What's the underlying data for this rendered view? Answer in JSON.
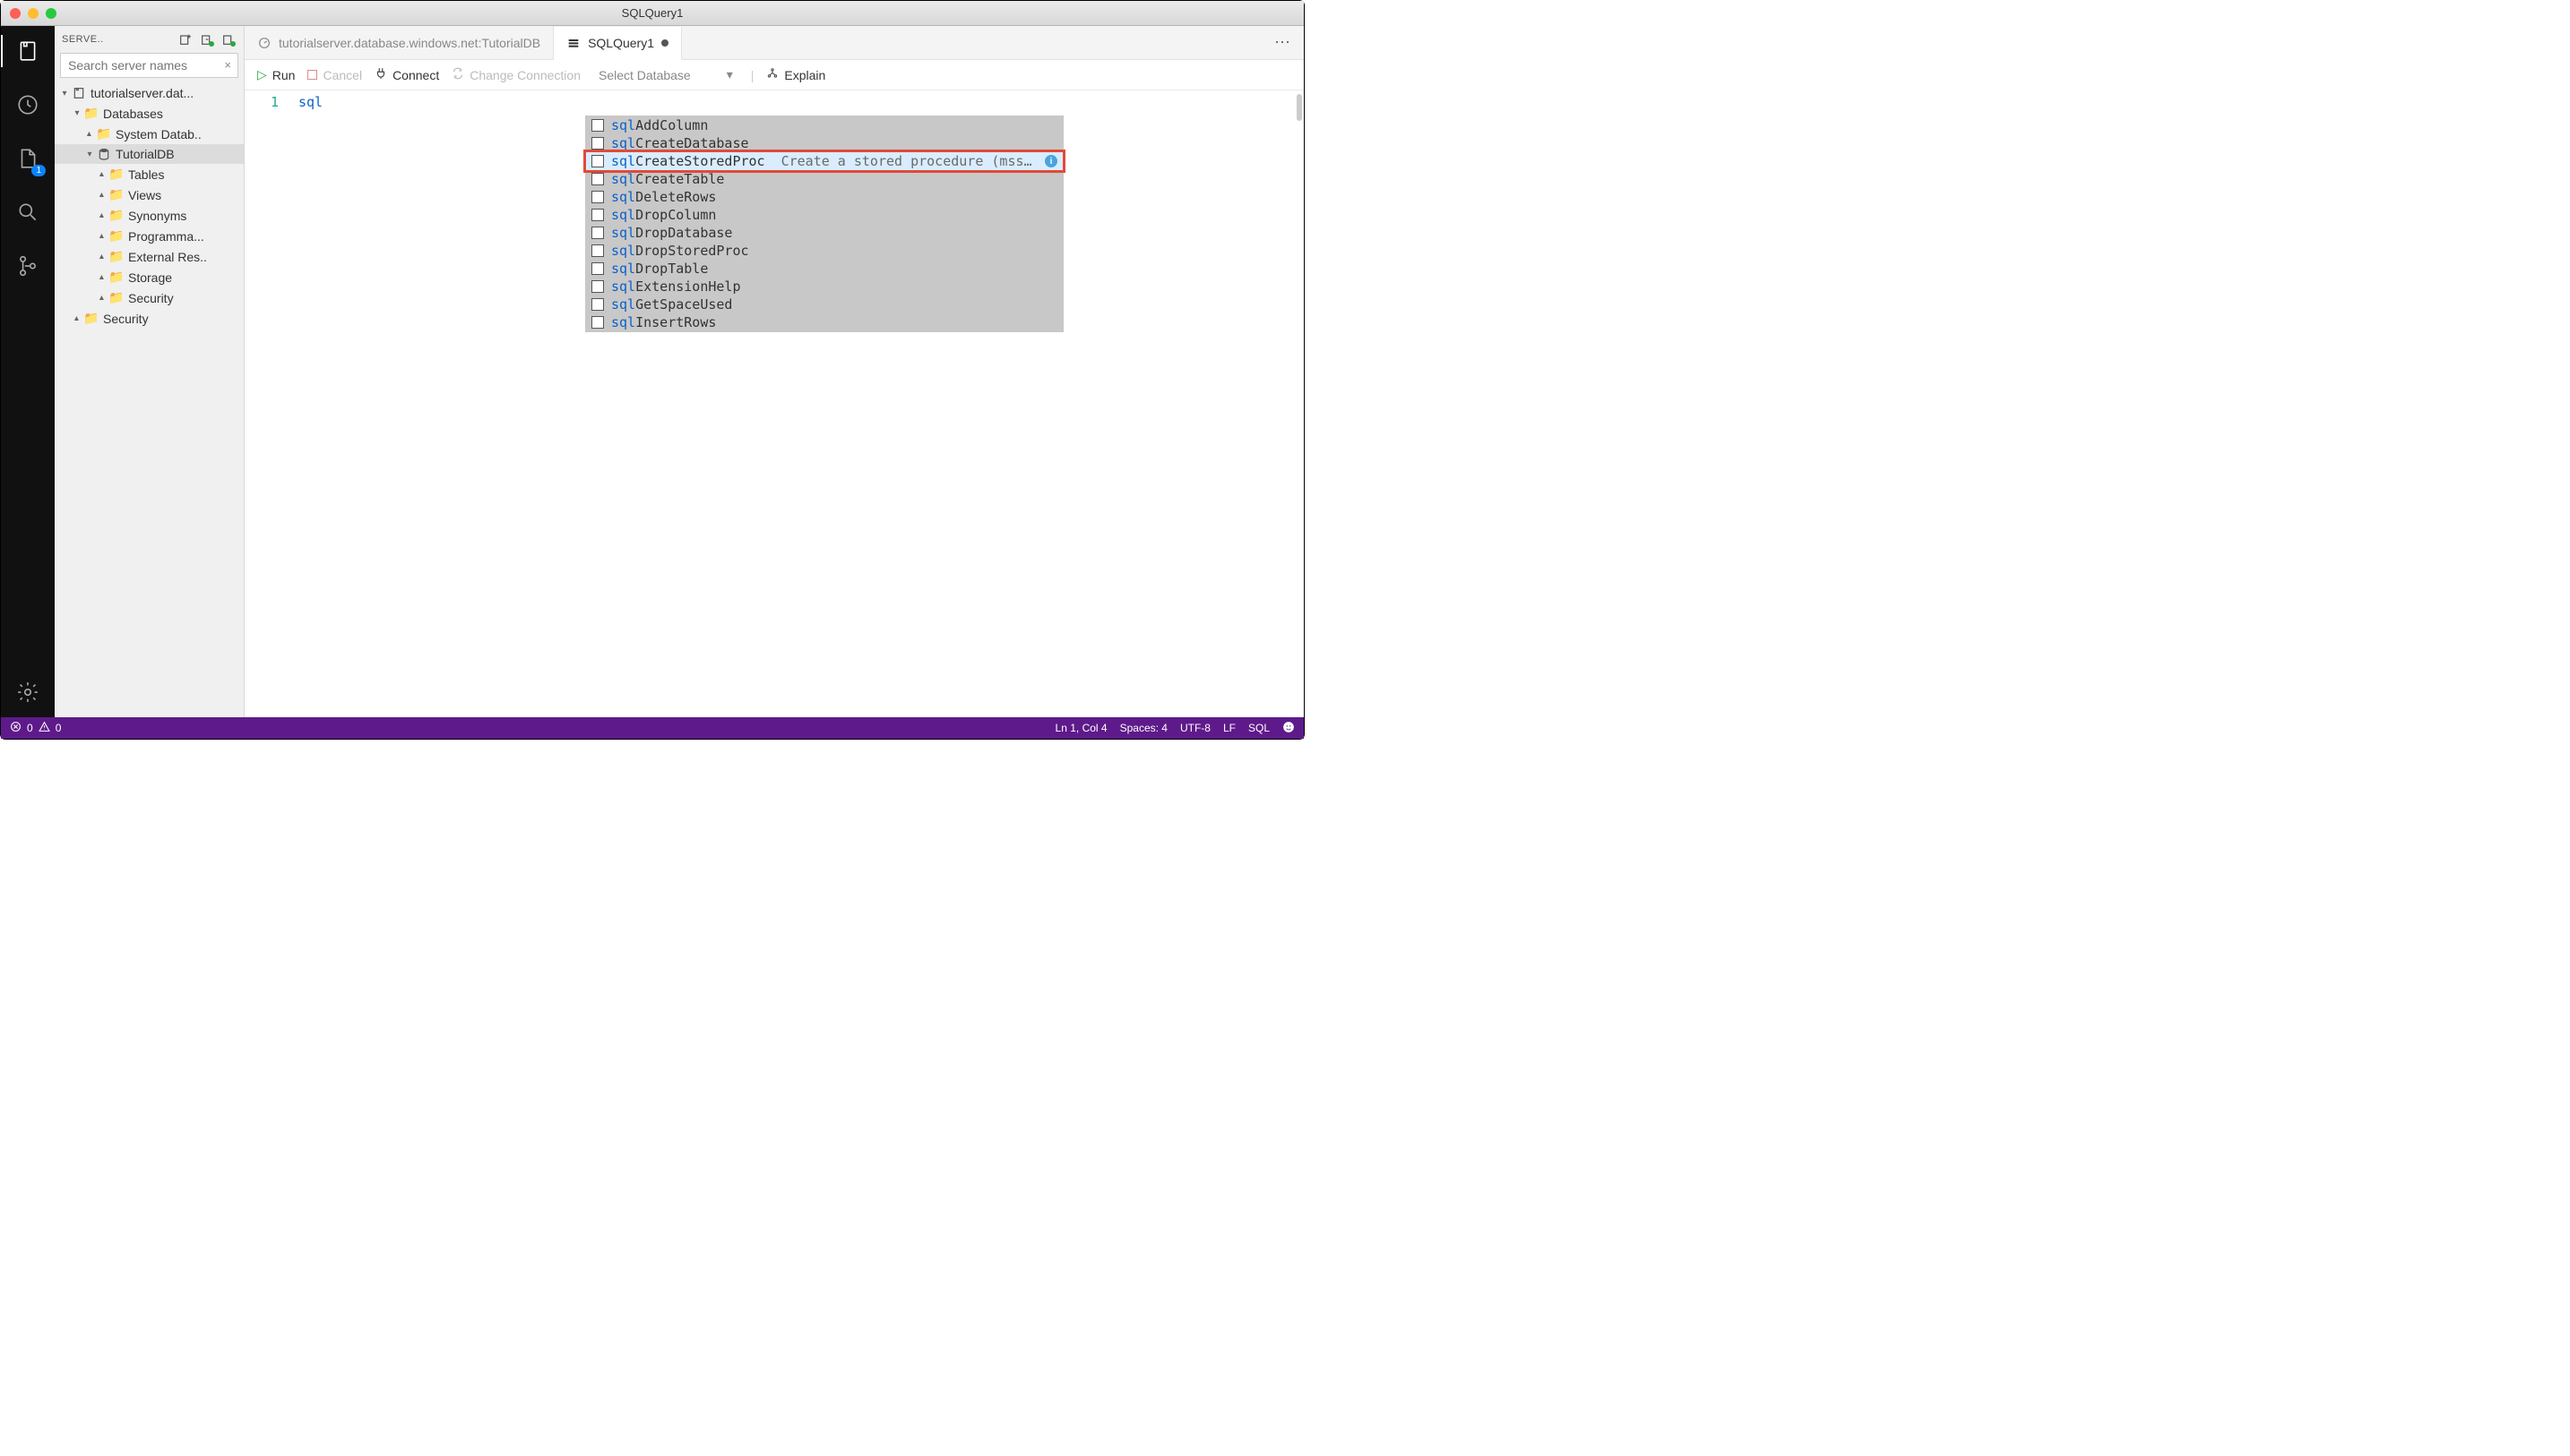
{
  "window": {
    "title": "SQLQuery1"
  },
  "sidebar": {
    "header_label": "SERVE..",
    "search_placeholder": "Search server names",
    "tree": {
      "server": "tutorialserver.dat...",
      "databases": "Databases",
      "systemdb": "System Datab..",
      "tutorialdb": "TutorialDB",
      "tables": "Tables",
      "views": "Views",
      "synonyms": "Synonyms",
      "programma": "Programma...",
      "extres": "External Res..",
      "storage": "Storage",
      "security_inner": "Security",
      "security_outer": "Security"
    }
  },
  "activitybar": {
    "badge": "1"
  },
  "tabs": {
    "server_tab": "tutorialserver.database.windows.net:TutorialDB",
    "query_tab": "SQLQuery1"
  },
  "toolbar": {
    "run": "Run",
    "cancel": "Cancel",
    "connect": "Connect",
    "change_conn": "Change Connection",
    "select_db": "Select Database",
    "explain": "Explain"
  },
  "editor": {
    "line_no": "1",
    "typed": "sql"
  },
  "suggestions": [
    {
      "key": "sql",
      "rest": "AddColumn",
      "selected": false,
      "highlight": false
    },
    {
      "key": "sql",
      "rest": "CreateDatabase",
      "selected": false,
      "highlight": false
    },
    {
      "key": "sql",
      "rest": "CreateStoredProc",
      "hint": "Create a stored procedure (mssq…",
      "selected": true,
      "highlight": true
    },
    {
      "key": "sql",
      "rest": "CreateTable",
      "selected": false,
      "highlight": false
    },
    {
      "key": "sql",
      "rest": "DeleteRows",
      "selected": false,
      "highlight": false
    },
    {
      "key": "sql",
      "rest": "DropColumn",
      "selected": false,
      "highlight": false
    },
    {
      "key": "sql",
      "rest": "DropDatabase",
      "selected": false,
      "highlight": false
    },
    {
      "key": "sql",
      "rest": "DropStoredProc",
      "selected": false,
      "highlight": false
    },
    {
      "key": "sql",
      "rest": "DropTable",
      "selected": false,
      "highlight": false
    },
    {
      "key": "sql",
      "rest": "ExtensionHelp",
      "selected": false,
      "highlight": false
    },
    {
      "key": "sql",
      "rest": "GetSpaceUsed",
      "selected": false,
      "highlight": false
    },
    {
      "key": "sql",
      "rest": "InsertRows",
      "selected": false,
      "highlight": false
    }
  ],
  "statusbar": {
    "errors": "0",
    "warnings": "0",
    "ln_col": "Ln 1, Col 4",
    "spaces": "Spaces: 4",
    "encoding": "UTF-8",
    "eol": "LF",
    "lang": "SQL"
  }
}
